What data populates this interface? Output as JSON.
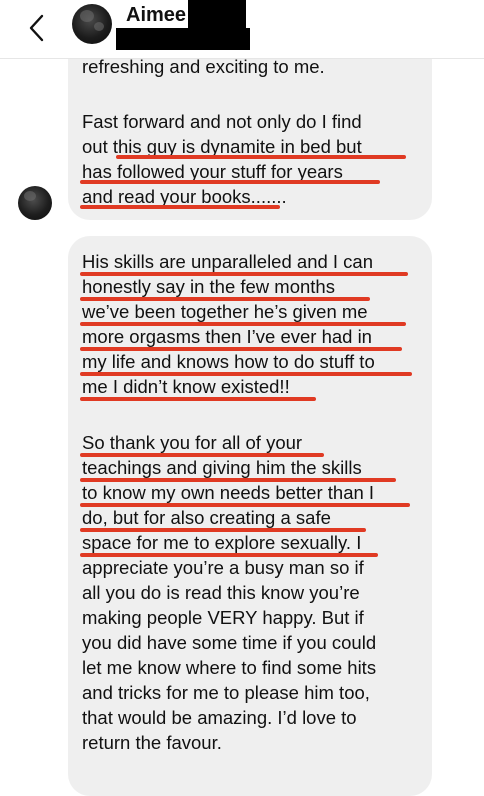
{
  "header": {
    "contact_name": "Aimee"
  },
  "messages": [
    {
      "lines": [
        "refreshing and exciting to me.",
        "",
        "Fast forward and not only do I find",
        "out this guy is dynamite in bed but",
        "has followed your stuff for years",
        "and read your books......."
      ]
    },
    {
      "lines": [
        "His skills are unparalleled and I can",
        "honestly say in the few months",
        "we’ve been together he’s given me",
        "more orgasms then I’ve ever had in",
        "my life and knows how to do stuff to",
        "me I didn’t know existed!!",
        "",
        "So thank you for all of your",
        "teachings and giving him the skills",
        "to know my own needs better than I",
        "do, but for also creating a safe",
        "space for me to explore sexually. I",
        "appreciate you’re a busy man so if",
        "all you do is read this know you’re",
        "making people VERY happy. But if",
        "you did have some time if you could",
        "let me know where to find some hits",
        "and tricks for me to please him too,",
        "that would be amazing. I’d love to",
        "return the favour."
      ]
    }
  ],
  "colors": {
    "highlight": "#e03a23",
    "bubble": "#efefef"
  },
  "icons": {
    "back": "chevron-left-icon"
  }
}
